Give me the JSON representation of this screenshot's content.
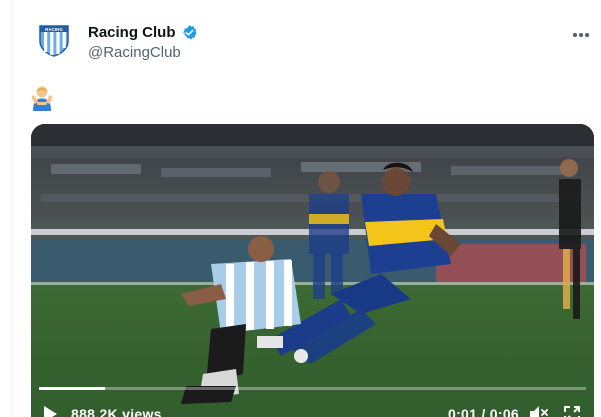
{
  "tweet": {
    "display_name": "Racing Club",
    "handle": "@RacingClub",
    "text_emoji": "person-gesturing-ok emoji",
    "verified": true,
    "avatar_icon": "racing-club-crest-icon",
    "colors": {
      "verified_blue": "#1d9bf0",
      "crest_blue": "#6cace4",
      "secondary_text": "#536471"
    }
  },
  "video": {
    "views": "888.2K views",
    "time": "0:01 / 0:06",
    "progress": 0.12,
    "play_icon": "play-icon",
    "volume_icon": "volume-icon",
    "fullscreen_icon": "fullscreen-icon"
  },
  "menu": {
    "more_icon": "more-options-icon"
  }
}
